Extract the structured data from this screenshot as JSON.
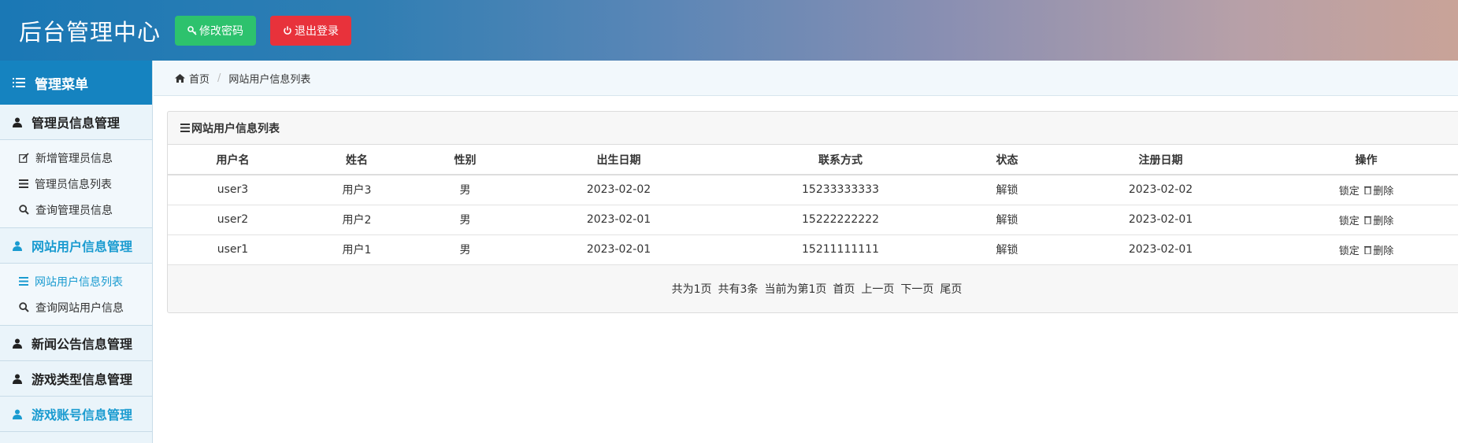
{
  "header": {
    "title": "后台管理中心",
    "change_password": "修改密码",
    "logout": "退出登录"
  },
  "sidebar": {
    "title": "管理菜单",
    "groups": [
      {
        "label": "管理员信息管理",
        "items": [
          {
            "label": "新增管理员信息",
            "icon": "edit-icon"
          },
          {
            "label": "管理员信息列表",
            "icon": "list-icon"
          },
          {
            "label": "查询管理员信息",
            "icon": "search-icon"
          }
        ]
      },
      {
        "label": "网站用户信息管理",
        "items": [
          {
            "label": "网站用户信息列表",
            "icon": "list-icon"
          },
          {
            "label": "查询网站用户信息",
            "icon": "search-icon"
          }
        ]
      },
      {
        "label": "新闻公告信息管理"
      },
      {
        "label": "游戏类型信息管理"
      },
      {
        "label": "游戏账号信息管理"
      }
    ]
  },
  "breadcrumb": {
    "home": "首页",
    "current": "网站用户信息列表"
  },
  "panel": {
    "title": "网站用户信息列表",
    "columns": [
      "用户名",
      "姓名",
      "性别",
      "出生日期",
      "联系方式",
      "状态",
      "注册日期",
      "操作"
    ],
    "rows": [
      {
        "username": "user3",
        "name": "用户3",
        "gender": "男",
        "birth": "2023-02-02",
        "phone": "15233333333",
        "status": "解锁",
        "reg": "2023-02-02",
        "lock": "锁定",
        "delete": "删除"
      },
      {
        "username": "user2",
        "name": "用户2",
        "gender": "男",
        "birth": "2023-02-01",
        "phone": "15222222222",
        "status": "解锁",
        "reg": "2023-02-01",
        "lock": "锁定",
        "delete": "删除"
      },
      {
        "username": "user1",
        "name": "用户1",
        "gender": "男",
        "birth": "2023-02-01",
        "phone": "15211111111",
        "status": "解锁",
        "reg": "2023-02-01",
        "lock": "锁定",
        "delete": "删除"
      }
    ],
    "pager": {
      "total_pages": "共为1页",
      "total_items": "共有3条",
      "current": "当前为第1页",
      "first": "首页",
      "prev": "上一页",
      "next": "下一页",
      "last": "尾页"
    }
  },
  "colors": {
    "primary": "#1583c0",
    "active": "#1a9bd0",
    "green": "#2dc26d",
    "red": "#e8323b"
  }
}
